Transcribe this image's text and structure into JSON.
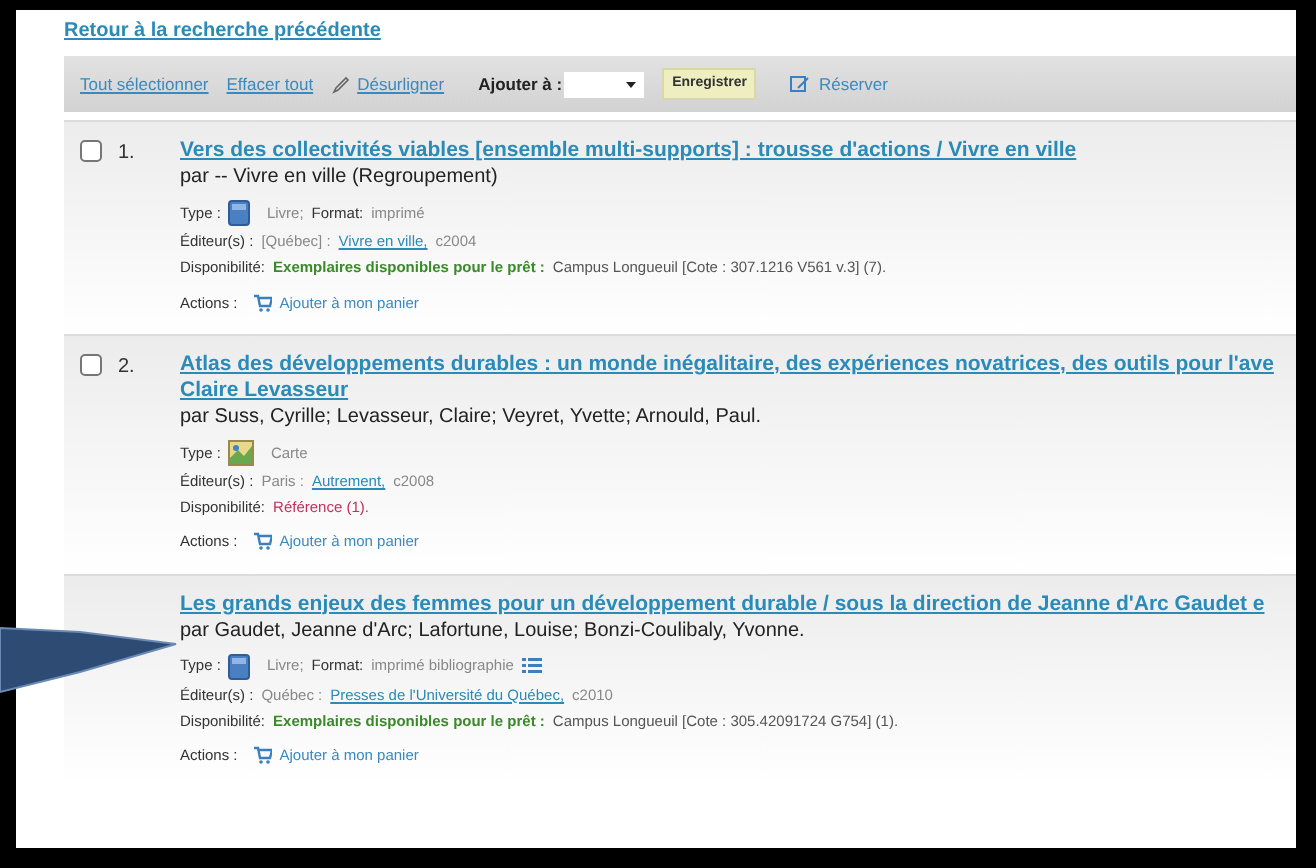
{
  "back_link": "Retour à la recherche précédente",
  "toolbar": {
    "select_all": "Tout sélectionner",
    "clear_all": "Effacer tout",
    "unhighlight": "Désurligner",
    "add_to_label": "Ajouter à :",
    "save": "Enregistrer",
    "reserve": "Réserver"
  },
  "results": [
    {
      "number": "1.",
      "checked": false,
      "title_lines": [
        "Vers des collectivités viables [ensemble multi-supports] : trousse d'actions / Vivre en ville"
      ],
      "author": "par -- Vivre en ville (Regroupement)",
      "type_label": "Type :",
      "kind": "book",
      "type": "Livre;",
      "format_label": "Format:",
      "format": "imprimé",
      "editor_label": "Éditeur(s) :",
      "place": "[Québec] :",
      "publisher": "Vivre en ville,",
      "date": "c2004",
      "availability_label": "Disponibilité:",
      "availability": {
        "kind": "available",
        "text": "Exemplaires disponibles pour le prêt :",
        "detail": "Campus Longueuil [Cote : 307.1216 V561 v.3] (7)."
      },
      "actions_label": "Actions :",
      "action": "Ajouter à mon panier"
    },
    {
      "number": "2.",
      "checked": false,
      "title_lines": [
        "Atlas des développements durables : un monde inégalitaire, des expériences novatrices, des outils pour l'ave",
        "Claire Levasseur"
      ],
      "author": "par Suss, Cyrille; Levasseur, Claire; Veyret, Yvette; Arnould, Paul.",
      "type_label": "Type :",
      "kind": "map",
      "type": "Carte",
      "editor_label": "Éditeur(s) :",
      "place": "Paris :",
      "publisher": "Autrement,",
      "date": "c2008",
      "availability_label": "Disponibilité:",
      "availability": {
        "kind": "reference",
        "text": "Référence (1)."
      },
      "actions_label": "Actions :",
      "action": "Ajouter à mon panier"
    },
    {
      "title_lines": [
        "Les grands enjeux des femmes pour un développement durable / sous la direction de Jeanne d'Arc Gaudet e"
      ],
      "author": "par Gaudet, Jeanne d'Arc; Lafortune, Louise; Bonzi-Coulibaly, Yvonne.",
      "type_label": "Type :",
      "kind": "book",
      "type": "Livre;",
      "format_label": "Format:",
      "format": "imprimé bibliographie",
      "list_icon": true,
      "editor_label": "Éditeur(s) :",
      "place": "Québec :",
      "publisher": "Presses de l'Université du Québec,",
      "date": "c2010",
      "availability_label": "Disponibilité:",
      "availability": {
        "kind": "available",
        "text": "Exemplaires disponibles pour le prêt :",
        "detail": "Campus Longueuil [Cote : 305.42091724 G754] (1)."
      },
      "actions_label": "Actions :",
      "action": "Ajouter à mon panier"
    }
  ]
}
